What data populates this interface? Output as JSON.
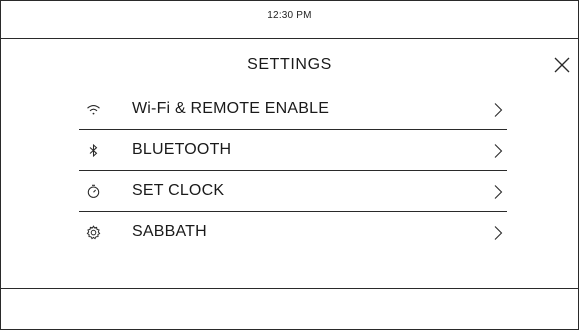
{
  "status_bar": {
    "time": "12:30 PM"
  },
  "header": {
    "title": "SETTINGS",
    "close_icon": "close-icon"
  },
  "menu": {
    "items": [
      {
        "label": "Wi-Fi & REMOTE ENABLE",
        "icon": "wifi-icon"
      },
      {
        "label": "BLUETOOTH",
        "icon": "bluetooth-icon"
      },
      {
        "label": "SET CLOCK",
        "icon": "timer-icon"
      },
      {
        "label": "SABBATH",
        "icon": "gear-icon"
      }
    ],
    "chevron_icon": "chevron-right-icon"
  },
  "colors": {
    "background": "#ffffff",
    "text": "#1a1a1a",
    "lines": "#2a2a2a"
  }
}
